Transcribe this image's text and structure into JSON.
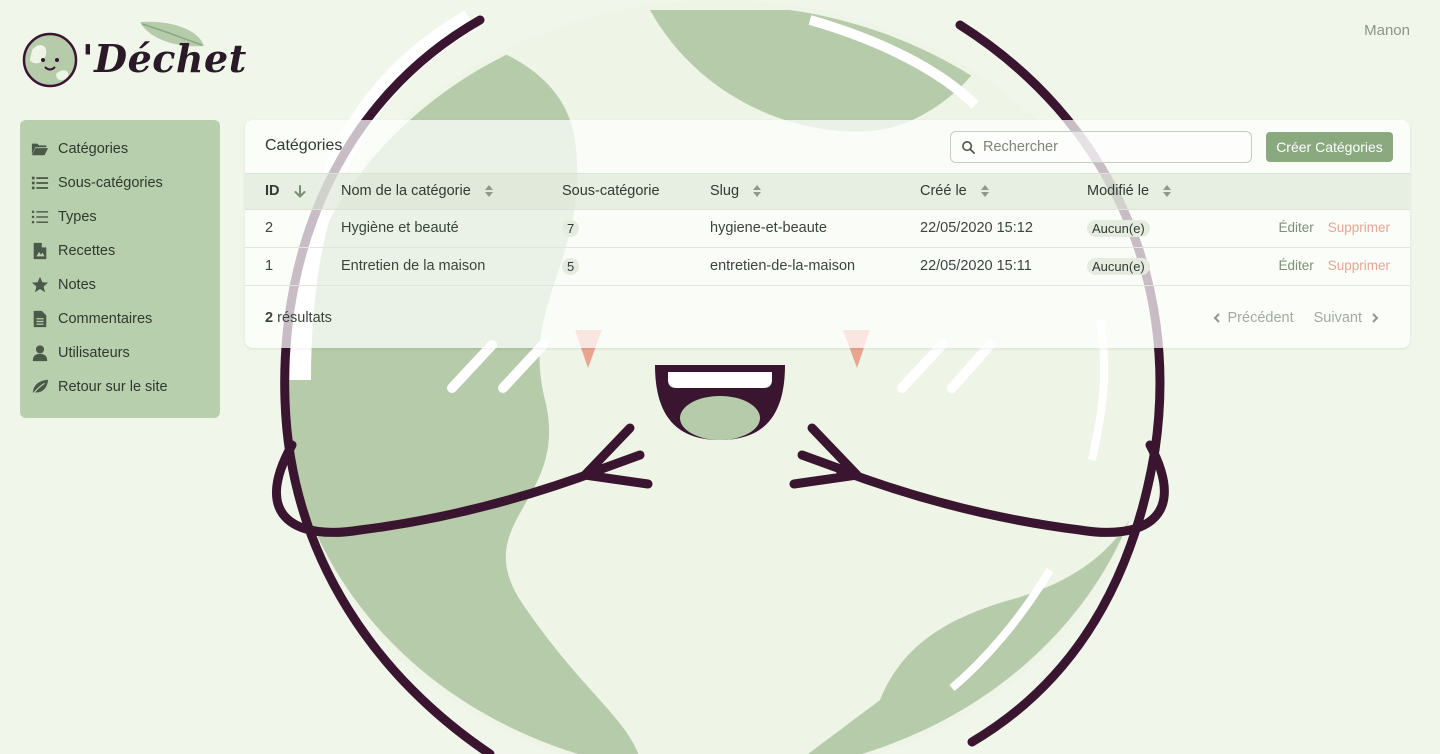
{
  "header": {
    "logo_text": "'Déchet",
    "user_name": "Manon"
  },
  "sidebar": {
    "items": [
      {
        "label": "Catégories",
        "icon": "folder-open-icon"
      },
      {
        "label": "Sous-catégories",
        "icon": "list-icon"
      },
      {
        "label": "Types",
        "icon": "list-icon"
      },
      {
        "label": "Recettes",
        "icon": "file-image-icon"
      },
      {
        "label": "Notes",
        "icon": "star-icon"
      },
      {
        "label": "Commentaires",
        "icon": "file-text-icon"
      },
      {
        "label": "Utilisateurs",
        "icon": "user-icon"
      },
      {
        "label": "Retour sur le site",
        "icon": "leaf-icon"
      }
    ]
  },
  "panel": {
    "title": "Catégories",
    "search_placeholder": "Rechercher",
    "create_label": "Créer Catégories"
  },
  "table": {
    "columns": [
      "ID",
      "Nom de la catégorie",
      "Sous-catégorie",
      "Slug",
      "Créé le",
      "Modifié le"
    ],
    "rows": [
      {
        "id": "2",
        "name": "Hygiène et beauté",
        "sub": "7",
        "slug": "hygiene-et-beaute",
        "created": "22/05/2020 15:12",
        "modified": "Aucun(e)",
        "edit": "Éditer",
        "delete": "Supprimer"
      },
      {
        "id": "1",
        "name": "Entretien de la maison",
        "sub": "5",
        "slug": "entretien-de-la-maison",
        "created": "22/05/2020 15:11",
        "modified": "Aucun(e)",
        "edit": "Éditer",
        "delete": "Supprimer"
      }
    ]
  },
  "footer": {
    "count": "2",
    "results_label": "résultats",
    "prev_label": "Précédent",
    "next_label": "Suivant"
  },
  "colors": {
    "background": "#f1f6ea",
    "sidebar": "#b8cfae",
    "accent_button": "#8aa97f",
    "danger_link": "#e4a693",
    "mascot_outline": "#3a1530",
    "mascot_fill": "#b5cba9"
  }
}
